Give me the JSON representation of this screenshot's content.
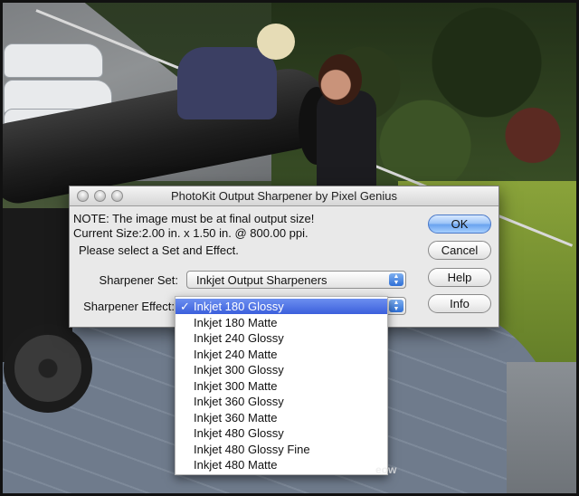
{
  "dialog": {
    "title": "PhotoKit Output Sharpener by Pixel Genius",
    "note": "NOTE: The image must be at final output size!",
    "current_size": "Current Size:2.00 in. x 1.50 in. @ 800.00 ppi.",
    "instruction": "Please select a Set and Effect.",
    "sharpener_set_label": "Sharpener Set:",
    "sharpener_set_value": "Inkjet Output Sharpeners",
    "sharpener_effect_label": "Sharpener Effect:",
    "buttons": {
      "ok": "OK",
      "cancel": "Cancel",
      "help": "Help",
      "info": "Info"
    }
  },
  "effect_menu": {
    "check_mark": "✓",
    "selected_index": 0,
    "items": [
      "Inkjet 180 Glossy",
      "Inkjet 180 Matte",
      "Inkjet 240 Glossy",
      "Inkjet 240 Matte",
      "Inkjet 300 Glossy",
      "Inkjet 300 Matte",
      "Inkjet 360 Glossy",
      "Inkjet 360 Matte",
      "Inkjet 480 Glossy",
      "Inkjet 480 Glossy Fine",
      "Inkjet 480 Matte"
    ]
  },
  "watermark": "eow",
  "colors": {
    "selection": "#3b5fdc",
    "default_button": "#6aa3ef"
  }
}
